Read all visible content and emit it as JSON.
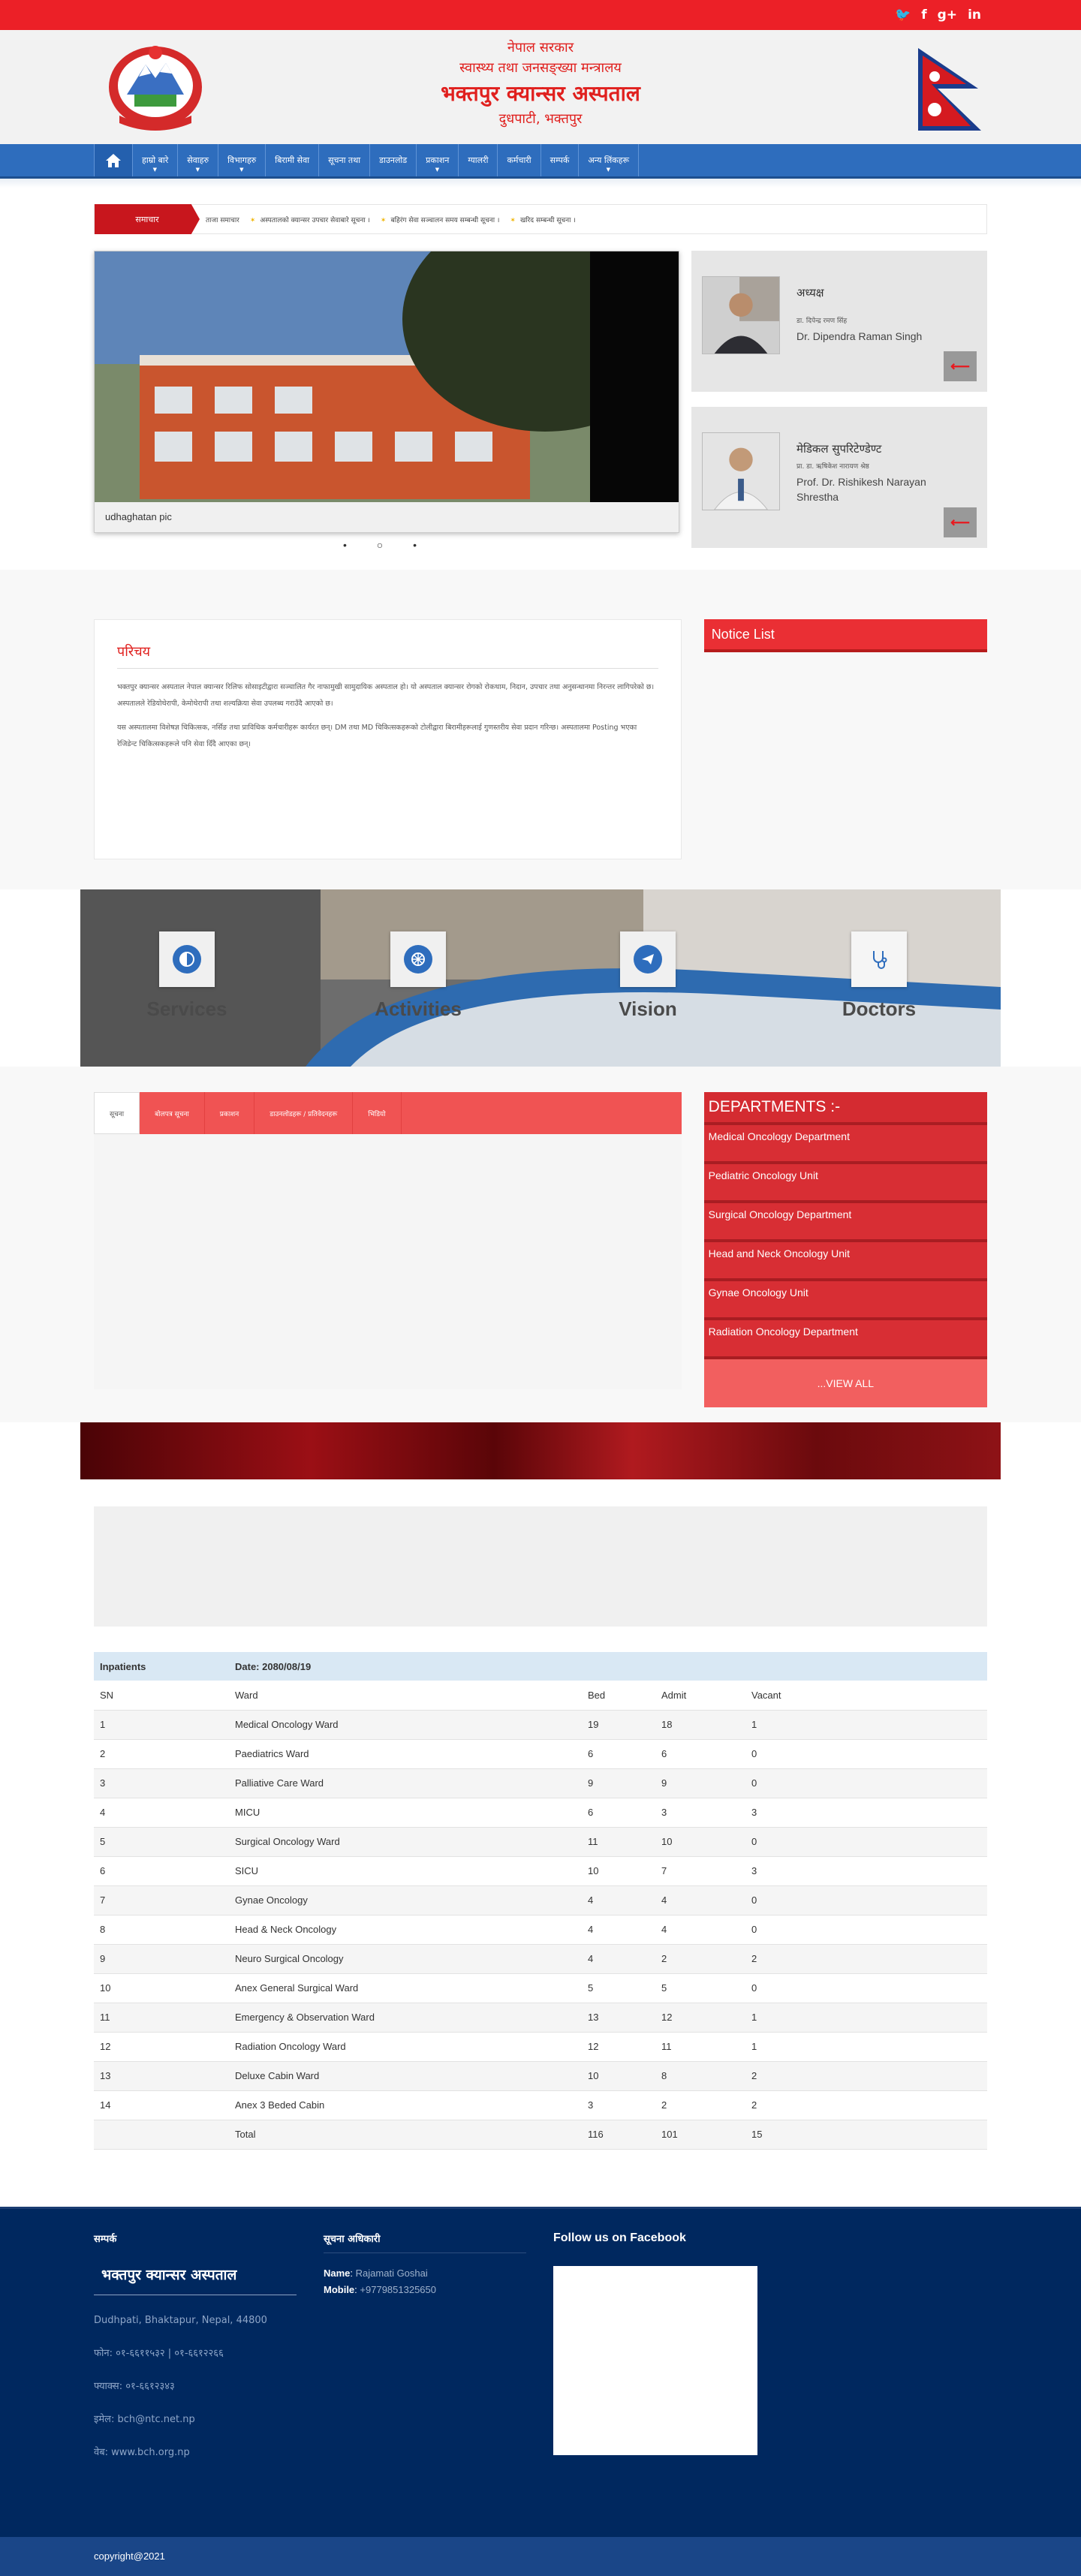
{
  "topbar": {
    "social": [
      "twitter-icon",
      "facebook-icon",
      "google-plus-icon",
      "linkedin-icon"
    ],
    "social_glyphs": [
      "🐦",
      "f",
      "g+",
      "in"
    ]
  },
  "header": {
    "line1": "नेपाल सरकार",
    "line2": "स्वास्थ्य तथा जनसङ्ख्या मन्त्रालय",
    "title": "भक्तपुर क्यान्सर अस्पताल",
    "location": "दुधपाटी, भक्तपुर"
  },
  "nav": {
    "items": [
      "हाम्रो बारे",
      "सेवाहरु",
      "विभागहरु",
      "बिरामी सेवा",
      "सूचना तथा",
      "डाउनलोड",
      "प्रकाशन",
      "ग्यालरी",
      "कर्मचारी",
      "सम्पर्क",
      "अन्य लिंकहरू"
    ]
  },
  "ticker": {
    "label": "समाचार",
    "items": [
      "ताजा समाचार",
      "अस्पतालको क्यान्सर उपचार सेवाबारे सूचना ।",
      "बहिरंग सेवा सञ्चालन समय सम्बन्धी सूचना ।",
      "खरिद सम्बन्धी सूचना ।"
    ]
  },
  "slider": {
    "caption": "udhaghatan pic",
    "dots": "• ○ •"
  },
  "profiles": [
    {
      "title": "अध्यक्ष",
      "sub": "डा. दिपेन्द्र रमण सिंह",
      "name": "Dr. Dipendra Raman Singh"
    },
    {
      "title": "मेडिकल सुपरिटेण्डेण्ट",
      "sub": "प्रा. डा. ऋषिकेश नारायण श्रेष्ठ",
      "name": "Prof. Dr. Rishikesh Narayan Shrestha"
    }
  ],
  "about": {
    "title": "परिचय",
    "p1": "भक्तपुर क्यान्सर अस्पताल नेपाल क्यान्सर रिलिफ सोसाइटीद्वारा सञ्चालित गैर नाफामुखी सामुदायिक अस्पताल हो। यो अस्पताल क्यान्सर रोगको रोकथाम, निदान, उपचार तथा अनुसन्धानमा निरन्तर लागिपरेको छ। अस्पतालले रेडियोथेरापी, केमोथेरापी तथा शल्यक्रिया सेवा उपलब्ध गराउँदै आएको छ।",
    "p2": "यस अस्पतालमा विशेषज्ञ चिकित्सक, नर्सिङ तथा प्राविधिक कर्मचारीहरू कार्यरत छन्। DM तथा MD चिकित्सकहरूको टोलीद्वारा बिरामीहरूलाई गुणस्तरीय सेवा प्रदान गरिन्छ। अस्पतालमा Posting भएका रेजिडेन्ट चिकित्सकहरूले पनि सेवा दिँदै आएका छन्।"
  },
  "notice": {
    "title": "Notice List"
  },
  "features": [
    {
      "label": "Services",
      "icon": "services-icon"
    },
    {
      "label": "Activities",
      "icon": "activities-icon"
    },
    {
      "label": "Vision",
      "icon": "vision-icon"
    },
    {
      "label": "Doctors",
      "icon": "doctors-icon"
    }
  ],
  "tabs": [
    "सूचना",
    "बोलपत्र सूचना",
    "प्रकाशन",
    "डाउनलोडहरू / प्रतिवेदनहरू",
    "भिडियो"
  ],
  "departments": {
    "title": "DEPARTMENTS :-",
    "items": [
      "Medical Oncology Department",
      "Pediatric Oncology Unit",
      "Surgical Oncology Department",
      "Head and Neck Oncology Unit",
      "Gynae Oncology Unit",
      "Radiation Oncology Department"
    ],
    "view_all": "...VIEW ALL"
  },
  "inpatients": {
    "heading": "Inpatients",
    "date": "Date: 2080/08/19",
    "columns": [
      "SN",
      "Ward",
      "Bed",
      "Admit",
      "Vacant"
    ],
    "rows": [
      [
        "1",
        "Medical Oncology Ward",
        "19",
        "18",
        "1"
      ],
      [
        "2",
        "Paediatrics Ward",
        "6",
        "6",
        "0"
      ],
      [
        "3",
        "Palliative Care Ward",
        "9",
        "9",
        "0"
      ],
      [
        "4",
        "MICU",
        "6",
        "3",
        "3"
      ],
      [
        "5",
        "Surgical Oncology Ward",
        "11",
        "10",
        "0"
      ],
      [
        "6",
        "SICU",
        "10",
        "7",
        "3"
      ],
      [
        "7",
        "Gynae Oncology",
        "4",
        "4",
        "0"
      ],
      [
        "8",
        "Head & Neck Oncology",
        "4",
        "4",
        "0"
      ],
      [
        "9",
        "Neuro Surgical Oncology",
        "4",
        "2",
        "2"
      ],
      [
        "10",
        "Anex General Surgical Ward",
        "5",
        "5",
        "0"
      ],
      [
        "11",
        "Emergency & Observation Ward",
        "13",
        "12",
        "1"
      ],
      [
        "12",
        "Radiation Oncology Ward",
        "12",
        "11",
        "1"
      ],
      [
        "13",
        "Deluxe Cabin Ward",
        "10",
        "8",
        "2"
      ],
      [
        "14",
        "Anex 3 Beded Cabin",
        "3",
        "2",
        "2"
      ]
    ],
    "total": [
      "",
      "Total",
      "116",
      "101",
      "15"
    ]
  },
  "footer": {
    "col1_title": "सम्पर्क",
    "hospital": "भक्तपुर क्यान्सर अस्पताल",
    "address": "Dudhpati, Bhaktapur, Nepal, 44800",
    "phone": "फोन: ०१-६६११५३२ | ०१-६६१२२६६",
    "fax": "फ्याक्स: ०१-६६१२३४३",
    "email": "इमेल: bch@ntc.net.np",
    "web": "वेब: www.bch.org.np",
    "col2_title": "सूचना अधिकारी",
    "name_label": "Name",
    "name": "Rajamati Goshai",
    "mobile_label": "Mobile",
    "mobile": "+9779851325650",
    "col3_title": "Follow us on Facebook",
    "copyright": "copyright@2021"
  }
}
